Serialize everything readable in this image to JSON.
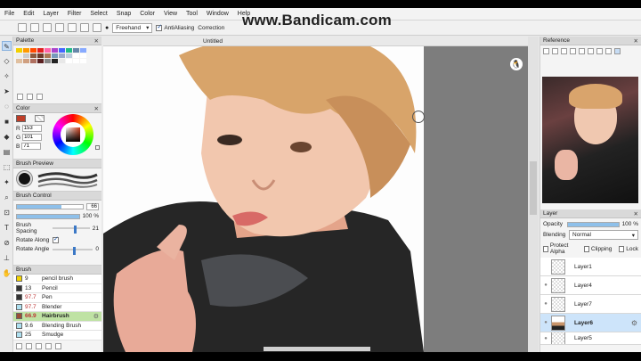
{
  "watermark": "www.Bandicam.com",
  "menu": [
    "File",
    "Edit",
    "Layer",
    "Filter",
    "Select",
    "Snap",
    "Color",
    "View",
    "Tool",
    "Window",
    "Help"
  ],
  "toolbar": {
    "mode": "Freehand",
    "antialiasing_label": "AntiAliasing",
    "correction_label": "Correction"
  },
  "canvas": {
    "tab_title": "Untitled"
  },
  "palette": {
    "title": "Palette",
    "swatches": [
      "#f2d000",
      "#ff9a00",
      "#ff4a00",
      "#e02020",
      "#ff66aa",
      "#aa44cc",
      "#4466ff",
      "#22bb88",
      "#6688aa",
      "#88aaff",
      "#eeeeee",
      "#cccccc",
      "#8a5a40",
      "#6a3a2a",
      "#aa7755",
      "#7799bb",
      "#99aacc",
      "#bbccdd",
      "#ffffff",
      "#ffffff",
      "#e0c0a0",
      "#d0a080",
      "#b07060",
      "#5a2020",
      "#888888",
      "#222222",
      "#e8e8e8",
      "#ffffff",
      "#ffffff",
      "#ffffff"
    ]
  },
  "color": {
    "title": "Color",
    "r": "153",
    "g": "101",
    "b": "71",
    "current": "#994d38"
  },
  "brush_preview": {
    "title": "Brush Preview"
  },
  "brush_control": {
    "title": "Brush Control",
    "size_value": "66",
    "opacity_value": "100 %",
    "spacing_label": "Brush Spacing",
    "spacing_value": "21",
    "rotate_along_label": "Rotate Along",
    "rotate_angle_label": "Rotate Angle",
    "rotate_angle_value": "0"
  },
  "brush": {
    "title": "Brush",
    "items": [
      {
        "size": "9",
        "name": "pencil brush",
        "color": "#f2d300"
      },
      {
        "size": "13",
        "name": "Pencil",
        "color": "#333333"
      },
      {
        "size": "97.7",
        "name": "Pen",
        "color": "#333333"
      },
      {
        "size": "97.7",
        "name": "Blender",
        "color": "#aee0f0"
      },
      {
        "size": "66.9",
        "name": "Hairbrush",
        "color": "#9a4f36"
      },
      {
        "size": "9.6",
        "name": "Blending Brush",
        "color": "#aee0f0"
      },
      {
        "size": "25",
        "name": "Smudge",
        "color": "#aee0f0"
      }
    ]
  },
  "reference": {
    "title": "Reference"
  },
  "layer": {
    "title": "Layer",
    "opacity_label": "Opacity",
    "opacity_value": "100 %",
    "blending_label": "Blending",
    "blending_value": "Normal",
    "protect_alpha_label": "Protect Alpha",
    "clipping_label": "Clipping",
    "lock_label": "Lock",
    "layers": [
      "Layer1",
      "Layer4",
      "Layer7",
      "Layer6",
      "Layer5"
    ]
  }
}
